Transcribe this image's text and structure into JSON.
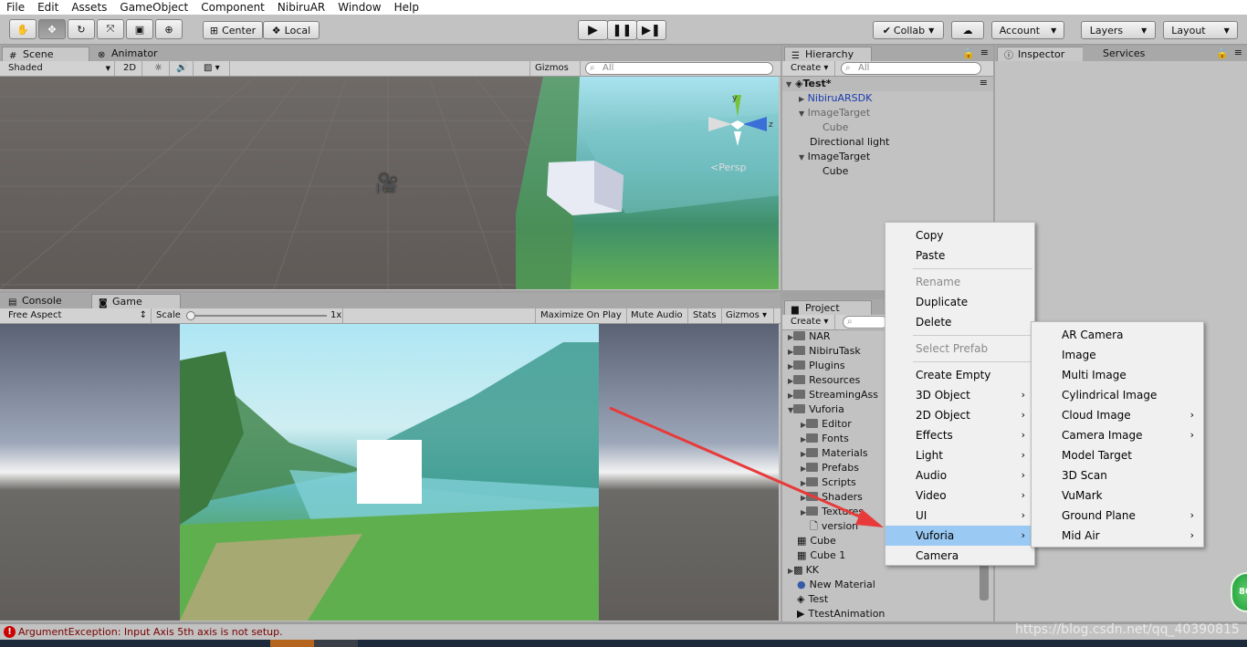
{
  "menu": [
    "File",
    "Edit",
    "Assets",
    "GameObject",
    "Component",
    "NibiruAR",
    "Window",
    "Help"
  ],
  "toolbar": {
    "pivot": "Center",
    "space": "Local",
    "collab": "Collab",
    "account": "Account",
    "layers": "Layers",
    "layout": "Layout"
  },
  "scene": {
    "tabs": [
      "Scene",
      "Animator"
    ],
    "shading": "Shaded",
    "mode_2d": "2D",
    "gizmos": "Gizmos",
    "search_placeholder": "All",
    "persp_label": "Persp",
    "axis_y": "y",
    "axis_z": "z"
  },
  "game": {
    "tabs": [
      "Console",
      "Game"
    ],
    "aspect": "Free Aspect",
    "scale_label": "Scale",
    "scale_value": "1x",
    "maximize": "Maximize On Play",
    "mute": "Mute Audio",
    "stats": "Stats",
    "gizmos": "Gizmos"
  },
  "hierarchy": {
    "tab": "Hierarchy",
    "create": "Create",
    "search_placeholder": "All",
    "scene_name": "Test*",
    "items": [
      "NibiruARSDK",
      "ImageTarget",
      "Cube",
      "Directional light",
      "ImageTarget",
      "Cube"
    ]
  },
  "inspector": {
    "tabs": [
      "Inspector",
      "Services"
    ]
  },
  "project": {
    "tab": "Project",
    "create": "Create",
    "items": [
      "NAR",
      "NibiruTask",
      "Plugins",
      "Resources",
      "StreamingAss",
      "Vuforia",
      "Editor",
      "Fonts",
      "Materials",
      "Prefabs",
      "Scripts",
      "Shaders",
      "Textures",
      "version",
      "Cube",
      "Cube 1",
      "KK",
      "New Material",
      "Test",
      "TtestAnimation"
    ]
  },
  "context_menu": {
    "items": [
      "Copy",
      "Paste",
      "Rename",
      "Duplicate",
      "Delete",
      "Select Prefab",
      "Create Empty",
      "3D Object",
      "2D Object",
      "Effects",
      "Light",
      "Audio",
      "Video",
      "UI",
      "Vuforia",
      "Camera"
    ]
  },
  "vuforia_submenu": {
    "items": [
      "AR Camera",
      "Image",
      "Multi Image",
      "Cylindrical Image",
      "Cloud Image",
      "Camera Image",
      "Model Target",
      "3D Scan",
      "VuMark",
      "Ground Plane",
      "Mid Air"
    ]
  },
  "status": {
    "message": "ArgumentException: Input Axis 5th axis is not setup.",
    "watermark": "https://blog.csdn.net/qq_40390815",
    "badge": "80"
  },
  "colors": {
    "highlight": "#9ac9f3",
    "error": "#cc0000",
    "prefab_blue": "#1a3bb0",
    "arrow_red": "#e83a3a"
  }
}
